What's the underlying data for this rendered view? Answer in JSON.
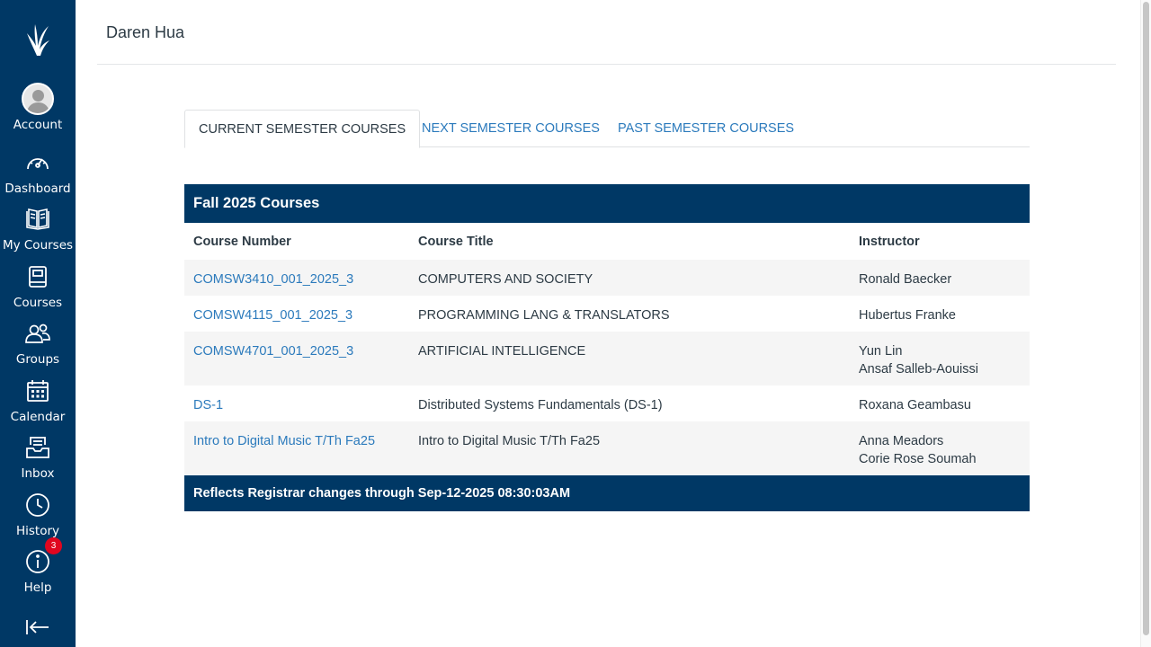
{
  "nav": {
    "logo": "columbia-crown-logo",
    "items": [
      {
        "label": "Account",
        "icon": "account-avatar"
      },
      {
        "label": "Dashboard",
        "icon": "dashboard-gauge-icon"
      },
      {
        "label": "My Courses",
        "icon": "open-book-icon"
      },
      {
        "label": "Courses",
        "icon": "book-icon"
      },
      {
        "label": "Groups",
        "icon": "groups-icon"
      },
      {
        "label": "Calendar",
        "icon": "calendar-icon"
      },
      {
        "label": "Inbox",
        "icon": "inbox-icon"
      },
      {
        "label": "History",
        "icon": "clock-icon"
      },
      {
        "label": "Help",
        "icon": "help-icon",
        "badge": "3"
      }
    ],
    "collapse_icon": "collapse-nav-icon"
  },
  "header": {
    "name": "Daren Hua"
  },
  "tabs": [
    {
      "label": "CURRENT SEMESTER COURSES",
      "active": true
    },
    {
      "label": "NEXT SEMESTER COURSES",
      "active": false
    },
    {
      "label": "PAST SEMESTER COURSES",
      "active": false
    }
  ],
  "table": {
    "title": "Fall 2025 Courses",
    "columns": [
      "Course Number",
      "Course Title",
      "Instructor"
    ],
    "rows": [
      {
        "number": "COMSW3410_001_2025_3",
        "title": "COMPUTERS AND SOCIETY",
        "instructors": [
          "Ronald Baecker"
        ]
      },
      {
        "number": "COMSW4115_001_2025_3",
        "title": "PROGRAMMING LANG & TRANSLATORS",
        "instructors": [
          "Hubertus Franke"
        ]
      },
      {
        "number": "COMSW4701_001_2025_3",
        "title": "ARTIFICIAL INTELLIGENCE",
        "instructors": [
          "Yun Lin",
          "Ansaf Salleb-Aouissi"
        ]
      },
      {
        "number": "DS-1",
        "title": "Distributed Systems Fundamentals (DS-1)",
        "instructors": [
          "Roxana Geambasu"
        ]
      },
      {
        "number": "Intro to Digital Music T/Th Fa25",
        "title": "Intro to Digital Music T/Th Fa25",
        "instructors": [
          "Anna Meadors",
          "Corie Rose Soumah"
        ]
      }
    ],
    "footer": "Reflects Registrar changes through Sep-12-2025 08:30:03AM"
  },
  "colors": {
    "nav_bg": "#003865",
    "link": "#2b7abc",
    "badge": "#e0061f"
  }
}
